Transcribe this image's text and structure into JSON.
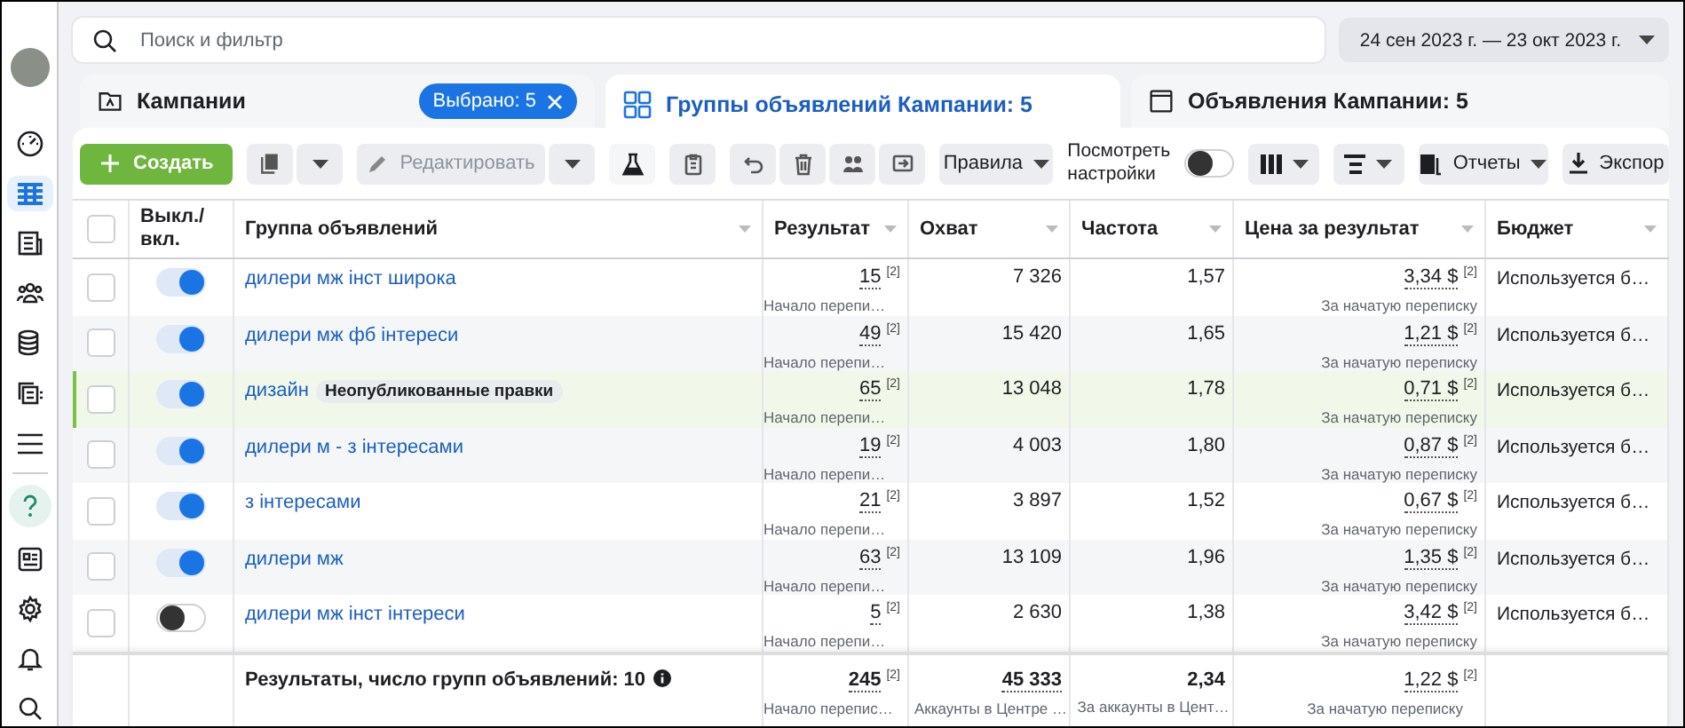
{
  "sidebar": {
    "items": [
      {
        "kind": "avatar",
        "selected": false
      },
      {
        "kind": "gauge",
        "selected": false
      },
      {
        "kind": "table",
        "selected": true
      },
      {
        "kind": "document",
        "selected": false
      },
      {
        "kind": "people",
        "selected": false
      },
      {
        "kind": "database",
        "selected": false
      },
      {
        "kind": "stack",
        "selected": false
      },
      {
        "kind": "menu",
        "selected": false
      },
      {
        "kind": "help",
        "selected": false
      },
      {
        "kind": "newspaper",
        "selected": false
      },
      {
        "kind": "settings",
        "selected": false
      },
      {
        "kind": "bell",
        "selected": false
      },
      {
        "kind": "search",
        "selected": false
      }
    ]
  },
  "search": {
    "placeholder": "Поиск и фильтр"
  },
  "date_range": {
    "label": "24 сен 2023 г. — 23 окт 2023 г."
  },
  "tabs": [
    {
      "kind": "campaigns",
      "label": "Кампании",
      "selected": false,
      "badge": "Выбрано: 5"
    },
    {
      "kind": "adsets",
      "label": "Группы объявлений Кампании: 5",
      "selected": true
    },
    {
      "kind": "ads",
      "label": "Объявления Кампании: 5",
      "selected": false
    }
  ],
  "toolbar": {
    "create": "Создать",
    "edit": "Редактировать",
    "rules": "Правила",
    "view_settings": "Посмотреть настройки",
    "view_settings_on": false,
    "reports": "Отчеты",
    "export": "Экспор"
  },
  "table": {
    "select_all_checked": false,
    "columns": [
      "Выкл./ вкл.",
      "Группа объявлений",
      "Результат",
      "Охват",
      "Частота",
      "Цена за результат",
      "Бюджет"
    ],
    "rows": [
      {
        "checked": false,
        "on": true,
        "edited": false,
        "name": "дилери мж інст широка",
        "result": "15",
        "result_note": "[2]",
        "result_sub": "Начало перепи…",
        "reach": "7 326",
        "frequency": "1,57",
        "cost": "3,34 $",
        "cost_note": "[2]",
        "cost_sub": "За начатую переписку",
        "budget": "Используется б…"
      },
      {
        "checked": false,
        "on": true,
        "edited": false,
        "name": "дилери мж фб інтереси",
        "result": "49",
        "result_note": "[2]",
        "result_sub": "Начало перепи…",
        "reach": "15 420",
        "frequency": "1,65",
        "cost": "1,21 $",
        "cost_note": "[2]",
        "cost_sub": "За начатую переписку",
        "budget": "Используется б…"
      },
      {
        "checked": false,
        "on": true,
        "edited": true,
        "name": "дизайн",
        "tag": "Неопубликованные правки",
        "result": "65",
        "result_note": "[2]",
        "result_sub": "Начало перепи…",
        "reach": "13 048",
        "frequency": "1,78",
        "cost": "0,71 $",
        "cost_note": "[2]",
        "cost_sub": "За начатую переписку",
        "budget": "Используется б…"
      },
      {
        "checked": false,
        "on": true,
        "edited": false,
        "name": "дилери м - з інтересами",
        "result": "19",
        "result_note": "[2]",
        "result_sub": "Начало перепи…",
        "reach": "4 003",
        "frequency": "1,80",
        "cost": "0,87 $",
        "cost_note": "[2]",
        "cost_sub": "За начатую переписку",
        "budget": "Используется б…"
      },
      {
        "checked": false,
        "on": true,
        "edited": false,
        "name": "з інтересами",
        "result": "21",
        "result_note": "[2]",
        "result_sub": "Начало перепи…",
        "reach": "3 897",
        "frequency": "1,52",
        "cost": "0,67 $",
        "cost_note": "[2]",
        "cost_sub": "За начатую переписку",
        "budget": "Используется б…"
      },
      {
        "checked": false,
        "on": true,
        "edited": false,
        "name": "дилери мж",
        "result": "63",
        "result_note": "[2]",
        "result_sub": "Начало перепи…",
        "reach": "13 109",
        "frequency": "1,96",
        "cost": "1,35 $",
        "cost_note": "[2]",
        "cost_sub": "За начатую переписку",
        "budget": "Используется б…"
      },
      {
        "checked": false,
        "on": false,
        "edited": false,
        "name": "дилери мж інст інтереси",
        "result": "5",
        "result_note": "[2]",
        "result_sub": "Начало перепи…",
        "reach": "2 630",
        "frequency": "1,38",
        "cost": "3,42 $",
        "cost_note": "[2]",
        "cost_sub": "За начатую переписку",
        "budget": "Используется б…"
      }
    ],
    "footer": {
      "label": "Результаты, число групп объявлений: 10",
      "result": "245",
      "result_note": "[2]",
      "result_sub": "Начало перепис…",
      "reach": "45 333",
      "reach_sub": "Аккаунты в Центре …",
      "frequency": "2,34",
      "frequency_sub": "За аккаунты в Цент…",
      "cost": "1,22 $",
      "cost_note": "[2]",
      "cost_sub": "За начатую переписку"
    }
  }
}
